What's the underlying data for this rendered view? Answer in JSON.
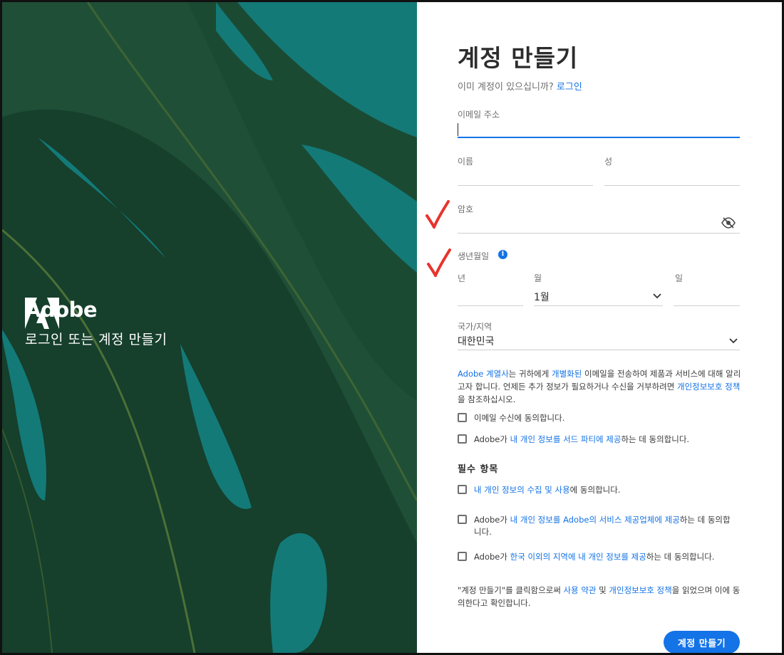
{
  "hero": {
    "brand_name": "Adobe",
    "tagline": "로그인 또는 계정 만들기",
    "colors": {
      "teal": "#137a78",
      "leaf_dark": "#183d2b",
      "leaf_mid": "#24533a"
    }
  },
  "form": {
    "title": "계정 만들기",
    "signin_prompt": "이미 계정이 있으십니까?",
    "signin_link": "로그인",
    "email_label": "이메일 주소",
    "email_value": "",
    "first_name_label": "이름",
    "last_name_label": "성",
    "password_label": "암호",
    "password_toggle_icon": "eye-slash-icon",
    "birthdate_label": "생년월일",
    "birthdate_info_icon": "info-icon",
    "year_label": "년",
    "month_label": "월",
    "month_value": "1월",
    "day_label": "일",
    "country_label": "국가/지역",
    "country_value": "대한민국",
    "marketing_notice": {
      "part1": "Adobe 계열사",
      "part2": "는 귀하에게 ",
      "part3": "개별화된",
      "part4": " 이메일을 전송하여 제품과 서비스에 대해 알리고자 합니다. 언제든 추가 정보가 필요하거나 수신을 거부하려면 ",
      "part5": "개인정보보호 정책",
      "part6": "을 참조하십시오."
    },
    "optional_checks": [
      {
        "text": "이메일 수신에 동의합니다."
      },
      {
        "pre": "Adobe가 ",
        "link": "내 개인 정보를 서드 파티에 제공",
        "post": "하는 데 동의합니다."
      }
    ],
    "required_heading": "필수 항목",
    "required_checks": [
      {
        "pre": "",
        "link": "내 개인 정보의 수집 및 사용",
        "post": "에 동의합니다."
      },
      {
        "pre": "Adobe가 ",
        "link": "내 개인 정보를 Adobe의 서비스 제공업체에 제공",
        "post": "하는 데 동의합니다."
      },
      {
        "pre": "Adobe가 ",
        "link": "한국 이외의 지역에 내 개인 정보를 제공",
        "post": "하는 데 동의합니다."
      }
    ],
    "terms_notice": {
      "part1": "\"계정 만들기\"를 클릭함으로써 ",
      "part2": "사용 약관",
      "part3": " 및 ",
      "part4": "개인정보보호 정책",
      "part5": "을 읽었으며 이에 동의한다고 확인합니다."
    },
    "submit_label": "계정 만들기"
  },
  "annotations": {
    "check_color": "#e8332c"
  },
  "colors": {
    "accent": "#1473e6",
    "label": "#6e6e6e",
    "divider": "#cfcfcf"
  }
}
